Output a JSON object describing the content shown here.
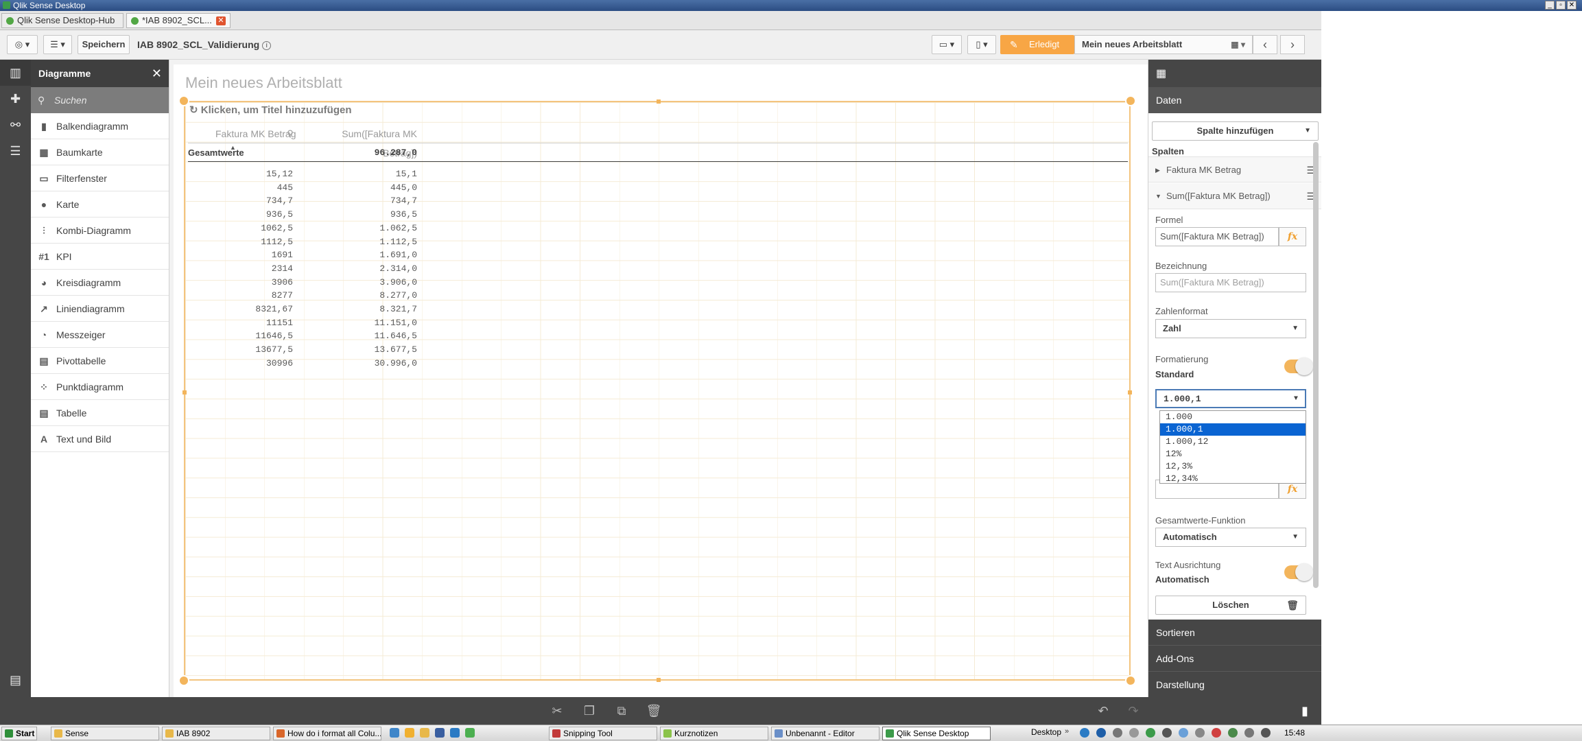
{
  "window": {
    "title": "Qlik Sense Desktop"
  },
  "tabs": [
    {
      "label": "Qlik Sense Desktop-Hub"
    },
    {
      "label": "*IAB 8902_SCL..."
    }
  ],
  "toolbar": {
    "save_label": "Speichern",
    "app_name": "IAB 8902_SCL_Validierung",
    "done_label": "Erledigt",
    "sheet_name": "Mein neues Arbeitsblatt"
  },
  "chart_panel": {
    "title": "Diagramme",
    "search_placeholder": "Suchen",
    "items": [
      {
        "label": "Balkendiagramm",
        "icon": "bar-chart-icon"
      },
      {
        "label": "Baumkarte",
        "icon": "treemap-icon"
      },
      {
        "label": "Filterfenster",
        "icon": "filter-pane-icon"
      },
      {
        "label": "Karte",
        "icon": "map-icon"
      },
      {
        "label": "Kombi-Diagramm",
        "icon": "combo-chart-icon"
      },
      {
        "label": "KPI",
        "icon": "kpi-icon",
        "glyph": "#1"
      },
      {
        "label": "Kreisdiagramm",
        "icon": "pie-chart-icon"
      },
      {
        "label": "Liniendiagramm",
        "icon": "line-chart-icon"
      },
      {
        "label": "Messzeiger",
        "icon": "gauge-icon"
      },
      {
        "label": "Pivottabelle",
        "icon": "pivot-table-icon"
      },
      {
        "label": "Punktdiagramm",
        "icon": "scatter-plot-icon"
      },
      {
        "label": "Tabelle",
        "icon": "table-icon"
      },
      {
        "label": "Text und Bild",
        "icon": "text-image-icon",
        "glyph": "A"
      }
    ]
  },
  "sheet": {
    "title": "Mein neues Arbeitsblatt",
    "object_title_hint": "Klicken, um Titel hinzuzufügen",
    "table": {
      "headers": [
        "Faktura MK Betrag",
        "Sum([Faktura MK Betrag])"
      ],
      "totals_label": "Gesamtwerte",
      "totals_value": "96.287,0",
      "rows": [
        [
          "15,12",
          "15,1"
        ],
        [
          "445",
          "445,0"
        ],
        [
          "734,7",
          "734,7"
        ],
        [
          "936,5",
          "936,5"
        ],
        [
          "1062,5",
          "1.062,5"
        ],
        [
          "1112,5",
          "1.112,5"
        ],
        [
          "1691",
          "1.691,0"
        ],
        [
          "2314",
          "2.314,0"
        ],
        [
          "3906",
          "3.906,0"
        ],
        [
          "8277",
          "8.277,0"
        ],
        [
          "8321,67",
          "8.321,7"
        ],
        [
          "11151",
          "11.151,0"
        ],
        [
          "11646,5",
          "11.646,5"
        ],
        [
          "13677,5",
          "13.677,5"
        ],
        [
          "30996",
          "30.996,0"
        ]
      ]
    }
  },
  "properties": {
    "daten_label": "Daten",
    "add_column_label": "Spalte hinzufügen",
    "columns_label": "Spalten",
    "columns": [
      "Faktura MK Betrag",
      "Sum([Faktura MK Betrag])"
    ],
    "formel_label": "Formel",
    "formel_value": "Sum([Faktura MK Betrag])",
    "fx": "fx",
    "bezeichnung_label": "Bezeichnung",
    "bezeichnung_placeholder": "Sum([Faktura MK Betrag])",
    "zahlenformat_label": "Zahlenformat",
    "zahlenformat_value": "Zahl",
    "formatierung_label": "Formatierung",
    "formatierung_value": "Standard",
    "format_select_value": "1.000,1",
    "format_options": [
      "1.000",
      "1.000,1",
      "1.000,12",
      "12%",
      "12,3%",
      "12,34%"
    ],
    "format_selected_index": 1,
    "gesamt_label": "Gesamtwerte-Funktion",
    "gesamt_value": "Automatisch",
    "text_align_label": "Text Ausrichtung",
    "text_align_value": "Automatisch",
    "delete_label": "Löschen",
    "sections": [
      "Sortieren",
      "Add-Ons",
      "Darstellung"
    ]
  },
  "taskbar": {
    "start_label": "Start",
    "items": [
      "Sense",
      "IAB 8902",
      "How do i format all Colu...",
      "Snipping Tool",
      "Kurznotizen",
      "Unbenannt - Editor",
      "Qlik Sense Desktop"
    ],
    "desktop_label": "Desktop",
    "clock": "15:48"
  },
  "colors": {
    "accent": "#f3b55c",
    "dark": "#464646",
    "selection": "#0a64d2"
  }
}
